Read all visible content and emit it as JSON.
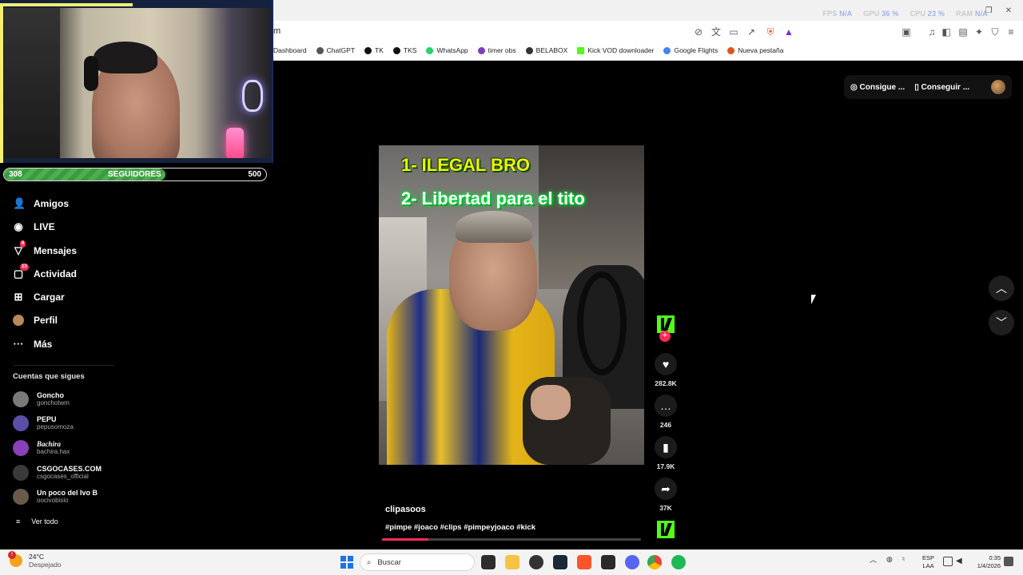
{
  "overlay": {
    "osd": [
      {
        "label": "FPS",
        "value": "N/A"
      },
      {
        "label": "GPU",
        "value": "36 %"
      },
      {
        "label": "CPU",
        "value": "23 %"
      },
      {
        "label": "RAM",
        "value": "N/A"
      }
    ],
    "followers_current": "308",
    "followers_label": "SEGUIDORES",
    "followers_goal": "500",
    "followers_progress": 0.616
  },
  "browser": {
    "url_fragment": "m",
    "bookmarks": [
      "Dashboard",
      "ChatGPT",
      "TK",
      "TKS",
      "WhatsApp",
      "timer obs",
      "BELABOX",
      "Kick VOD downloader",
      "Google Flights",
      "Nueva pestaña"
    ]
  },
  "header": {
    "get_coins": "Consigue ...",
    "get_app": "Conseguir ..."
  },
  "sidebar": {
    "items": [
      {
        "label": "Amigos",
        "icon": "friends-icon"
      },
      {
        "label": "LIVE",
        "icon": "live-icon"
      },
      {
        "label": "Mensajes",
        "icon": "messages-icon",
        "badge": "6"
      },
      {
        "label": "Actividad",
        "icon": "activity-icon",
        "badge": "13"
      },
      {
        "label": "Cargar",
        "icon": "upload-icon"
      },
      {
        "label": "Perfil",
        "icon": "profile-icon"
      },
      {
        "label": "Más",
        "icon": "more-icon"
      }
    ],
    "following_title": "Cuentas que sigues",
    "accounts": [
      {
        "name": "Goncho",
        "handle": "gonchotwm",
        "color": "#7a7a7a"
      },
      {
        "name": "PEPU",
        "handle": "pepusomoza",
        "color": "#5a4ea8"
      },
      {
        "name": "Bachira",
        "handle": "bachira.hax",
        "color": "#8b3fb8"
      },
      {
        "name": "CSGOCASES.COM",
        "handle": "csgocases_official",
        "color": "#3a3a3a"
      },
      {
        "name": "Un poco del Ivo B",
        "handle": "oocivobisio",
        "color": "#6a5a4a"
      }
    ],
    "see_all": "Ver todo"
  },
  "video": {
    "overlay_line1": "1- ILEGAL BRO",
    "overlay_line2": "2- Libertad para el tito",
    "author": "clipasoos",
    "hashtags": "#pimpe #joaco #clips #pimpeyjoaco #kick",
    "progress": 0.18,
    "likes": "282.8K",
    "comments": "246",
    "saves": "17.9K",
    "shares": "37K"
  },
  "taskbar": {
    "temp": "24°C",
    "weather": "Despejado",
    "search_placeholder": "Buscar",
    "lang1": "ESP",
    "lang2": "LAA",
    "time": "0:35",
    "date": "1/4/2026"
  }
}
